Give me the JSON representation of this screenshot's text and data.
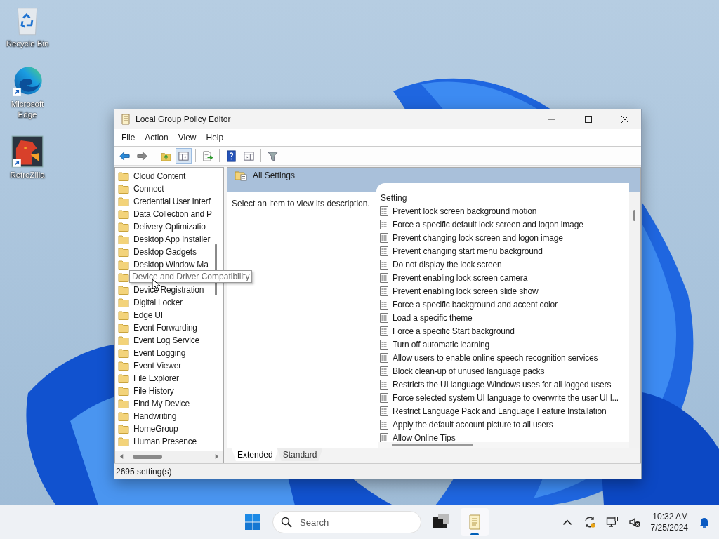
{
  "desktop": {
    "icons": [
      {
        "kind": "recycle",
        "label": "Recycle Bin"
      },
      {
        "kind": "edge",
        "label": "Microsoft Edge"
      },
      {
        "kind": "dragon",
        "label": "RetroZilla"
      }
    ]
  },
  "window": {
    "title": "Local Group Policy Editor",
    "menu": [
      "File",
      "Action",
      "View",
      "Help"
    ],
    "toolbar": [
      {
        "kind": "back",
        "pressed": false
      },
      {
        "kind": "forward",
        "pressed": false
      },
      {
        "kind": "separator"
      },
      {
        "kind": "up",
        "pressed": false
      },
      {
        "kind": "tree",
        "pressed": true
      },
      {
        "kind": "separator"
      },
      {
        "kind": "export",
        "pressed": false
      },
      {
        "kind": "separator"
      },
      {
        "kind": "help",
        "pressed": false
      },
      {
        "kind": "actionpane",
        "pressed": false
      },
      {
        "kind": "separator"
      },
      {
        "kind": "filter",
        "pressed": false
      }
    ],
    "tree": [
      {
        "label": "Cloud Content",
        "tooltip": false
      },
      {
        "label": "Connect",
        "tooltip": false
      },
      {
        "label": "Credential User Interf",
        "tooltip": false
      },
      {
        "label": "Data Collection and P",
        "tooltip": false
      },
      {
        "label": "Delivery Optimizatio",
        "tooltip": false
      },
      {
        "label": "Desktop App Installer",
        "tooltip": false
      },
      {
        "label": "Desktop Gadgets",
        "tooltip": false
      },
      {
        "label": "Desktop Window Ma",
        "tooltip": false
      },
      {
        "label": "Device and Driver Compatibility",
        "tooltip": true
      },
      {
        "label": "Device Registration",
        "tooltip": false
      },
      {
        "label": "Digital Locker",
        "tooltip": false
      },
      {
        "label": "Edge UI",
        "tooltip": false
      },
      {
        "label": "Event Forwarding",
        "tooltip": false
      },
      {
        "label": "Event Log Service",
        "tooltip": false
      },
      {
        "label": "Event Logging",
        "tooltip": false
      },
      {
        "label": "Event Viewer",
        "tooltip": false
      },
      {
        "label": "File Explorer",
        "tooltip": false
      },
      {
        "label": "File History",
        "tooltip": false
      },
      {
        "label": "Find My Device",
        "tooltip": false
      },
      {
        "label": "Handwriting",
        "tooltip": false
      },
      {
        "label": "HomeGroup",
        "tooltip": false
      },
      {
        "label": "Human Presence",
        "tooltip": false
      }
    ],
    "pane": {
      "header": "All Settings",
      "description": "Select an item to view its description.",
      "column": "Setting",
      "settings": [
        "Prevent lock screen background motion",
        "Force a specific default lock screen and logon image",
        "Prevent changing lock screen and logon image",
        "Prevent changing start menu background",
        "Do not display the lock screen",
        "Prevent enabling lock screen camera",
        "Prevent enabling lock screen slide show",
        "Force a specific background and accent color",
        "Load a specific theme",
        "Force a specific Start background",
        "Turn off automatic learning",
        "Allow users to enable online speech recognition services",
        "Block clean-up of unused language packs",
        "Restricts the UI language Windows uses for all logged users",
        "Force selected system UI language to overwrite the user UI l...",
        "Restrict Language Pack and Language Feature Installation",
        "Apply the default account picture to all users",
        "Allow Online Tips"
      ]
    },
    "tabs": [
      {
        "label": "Extended",
        "selected": true
      },
      {
        "label": "Standard",
        "selected": false
      }
    ],
    "status_bar": "2695 setting(s)"
  },
  "taskbar": {
    "search": {
      "placeholder": "Search"
    },
    "apps": [
      {
        "kind": "terminal",
        "active": false
      },
      {
        "kind": "policy",
        "active": true
      }
    ],
    "tray": [
      {
        "kind": "chevron"
      },
      {
        "kind": "sync"
      },
      {
        "kind": "monitor"
      },
      {
        "kind": "mute"
      }
    ],
    "clock": {
      "time": "10:32 AM",
      "date": "7/25/2024"
    }
  }
}
